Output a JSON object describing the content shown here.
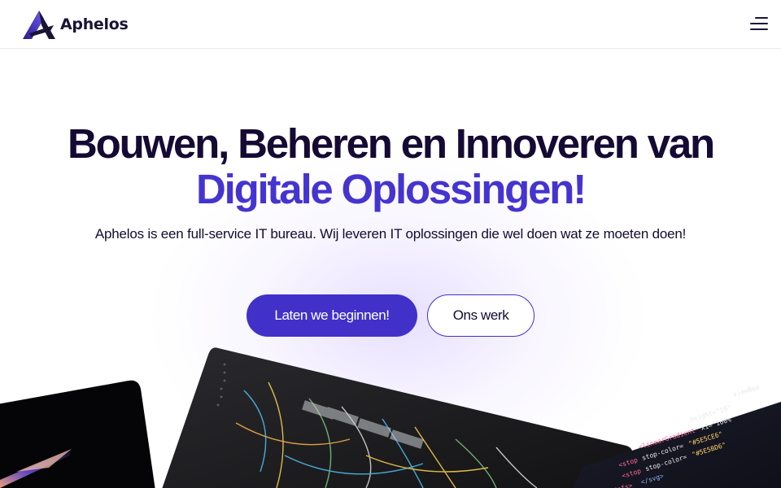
{
  "header": {
    "brand": "Aphelos",
    "logo_icon": "aphelos-logo-triangle",
    "menu_icon": "hamburger-menu-icon"
  },
  "hero": {
    "title_line1": "Bouwen, Beheren en Innoveren van",
    "title_line2": "Digitale Oplossingen!",
    "subtitle": "Aphelos is een full-service IT bureau. Wij leveren IT oplossingen die wel doen wat ze moeten doen!",
    "primary_cta": "Laten we beginnen!",
    "secondary_cta": "Ons werk"
  },
  "colors": {
    "accent": "#4131c9",
    "heading": "#150a33",
    "heading_accent": "#4534d0"
  },
  "showcase": {
    "cards": [
      "laptop-screen-image",
      "server-rack-cables-image",
      "code-editor-image"
    ]
  }
}
